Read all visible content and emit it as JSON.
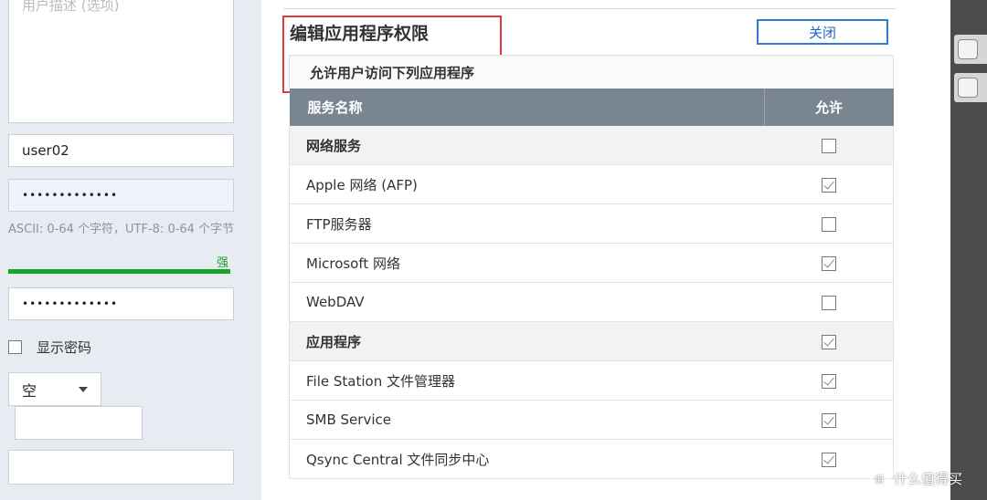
{
  "left_form": {
    "description_placeholder": "用户描述 (选项)",
    "username": "user02",
    "password_masked": "•••••••••••••",
    "password_hint": "ASCII: 0-64 个字符，UTF-8: 0-64 个字节",
    "strength_label": "强",
    "strength_color": "#1aa22b",
    "confirm_password_masked": "•••••••••••••",
    "show_password_label": "显示密码",
    "quota_select_value": "空"
  },
  "dialog": {
    "title": "编辑应用程序权限",
    "close_label": "关闭",
    "subtitle": "允许用户访问下列应用程序",
    "columns": {
      "name": "服务名称",
      "allow": "允许"
    },
    "rows": [
      {
        "label": "网络服务",
        "group": true,
        "checked": false
      },
      {
        "label": "Apple 网络 (AFP)",
        "group": false,
        "checked": true
      },
      {
        "label": "FTP服务器",
        "group": false,
        "checked": false
      },
      {
        "label": "Microsoft 网络",
        "group": false,
        "checked": true
      },
      {
        "label": "WebDAV",
        "group": false,
        "checked": false
      },
      {
        "label": "应用程序",
        "group": true,
        "checked": true
      },
      {
        "label": "File Station 文件管理器",
        "group": false,
        "checked": true
      },
      {
        "label": "SMB Service",
        "group": false,
        "checked": true
      },
      {
        "label": "Qsync Central 文件同步中心",
        "group": false,
        "checked": true
      }
    ],
    "accent_color": "#2e7bcf",
    "highlight_frame_color": "#e13a3a"
  },
  "watermark": {
    "text": "什么值得买",
    "logo_glyph": "值"
  }
}
